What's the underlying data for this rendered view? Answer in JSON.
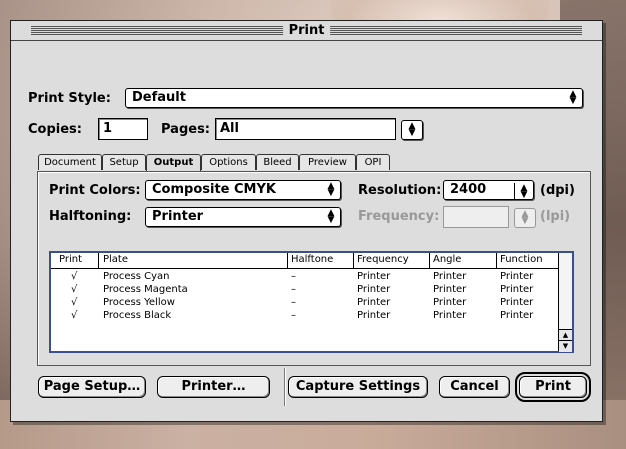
{
  "window": {
    "title": "Print"
  },
  "print_style": {
    "label": "Print Style:",
    "value": "Default"
  },
  "copies": {
    "label": "Copies:",
    "value": "1"
  },
  "pages": {
    "label": "Pages:",
    "value": "All"
  },
  "tabs": [
    {
      "label": "Document",
      "active": false
    },
    {
      "label": "Setup",
      "active": false
    },
    {
      "label": "Output",
      "active": true
    },
    {
      "label": "Options",
      "active": false
    },
    {
      "label": "Bleed",
      "active": false
    },
    {
      "label": "Preview",
      "active": false
    },
    {
      "label": "OPI",
      "active": false
    }
  ],
  "output": {
    "print_colors": {
      "label": "Print Colors:",
      "value": "Composite CMYK"
    },
    "halftoning": {
      "label": "Halftoning:",
      "value": "Printer"
    },
    "resolution": {
      "label": "Resolution:",
      "value": "2400",
      "unit": "(dpi)"
    },
    "frequency": {
      "label": "Frequency:",
      "value": "",
      "unit": "(lpi)"
    }
  },
  "plates_table": {
    "columns": [
      "Print",
      "Plate",
      "Halftone",
      "Frequency",
      "Angle",
      "Function"
    ],
    "rows": [
      {
        "print": "√",
        "plate": "Process Cyan",
        "halftone": "–",
        "frequency": "Printer",
        "angle": "Printer",
        "function": "Printer"
      },
      {
        "print": "√",
        "plate": "Process Magenta",
        "halftone": "–",
        "frequency": "Printer",
        "angle": "Printer",
        "function": "Printer"
      },
      {
        "print": "√",
        "plate": "Process Yellow",
        "halftone": "–",
        "frequency": "Printer",
        "angle": "Printer",
        "function": "Printer"
      },
      {
        "print": "√",
        "plate": "Process Black",
        "halftone": "–",
        "frequency": "Printer",
        "angle": "Printer",
        "function": "Printer"
      }
    ]
  },
  "buttons": {
    "page_setup": "Page Setup…",
    "printer": "Printer…",
    "capture_settings": "Capture Settings",
    "cancel": "Cancel",
    "print": "Print"
  },
  "icons": {
    "popup_arrows": "up-down-arrows-icon",
    "check": "checkmark-icon"
  }
}
